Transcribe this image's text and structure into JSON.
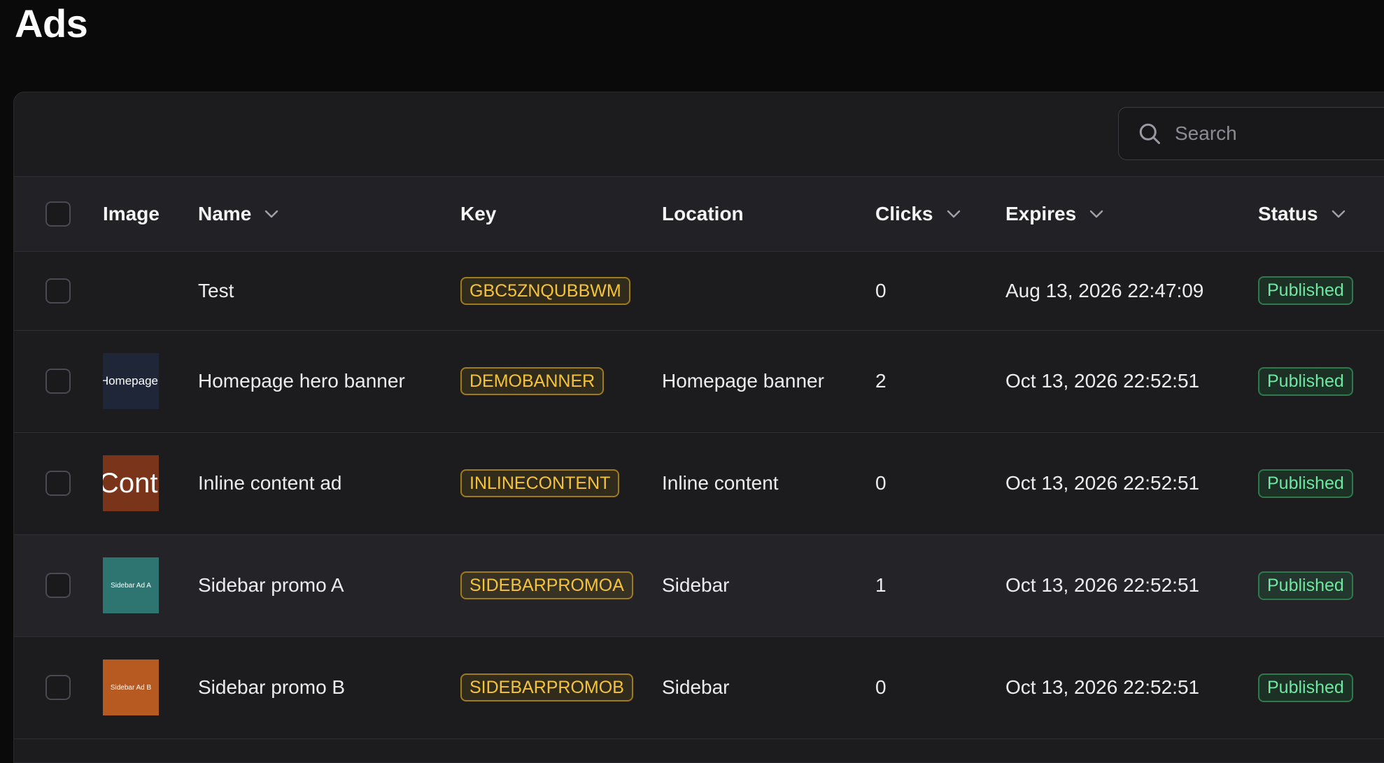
{
  "page": {
    "title": "Ads"
  },
  "search": {
    "placeholder": "Search",
    "value": ""
  },
  "table": {
    "columns": {
      "image": "Image",
      "name": "Name",
      "key": "Key",
      "location": "Location",
      "clicks": "Clicks",
      "expires": "Expires",
      "status": "Status"
    },
    "rows": [
      {
        "image_text": "",
        "image_bg": "",
        "name": "Test",
        "key": "GBC5ZNQUBBWM",
        "location": "",
        "clicks": "0",
        "expires": "Aug 13, 2026 22:47:09",
        "status": "Published"
      },
      {
        "image_text": "Homepage",
        "image_bg": "#1e2638",
        "name": "Homepage hero banner",
        "key": "DEMOBANNER",
        "location": "Homepage banner",
        "clicks": "2",
        "expires": "Oct 13, 2026 22:52:51",
        "status": "Published"
      },
      {
        "image_text": "Content",
        "image_bg": "#7a3419",
        "name": "Inline content ad",
        "key": "INLINECONTENT",
        "location": "Inline content",
        "clicks": "0",
        "expires": "Oct 13, 2026 22:52:51",
        "status": "Published"
      },
      {
        "image_text": "Sidebar Ad A",
        "image_bg": "#2e7470",
        "name": "Sidebar promo A",
        "key": "SIDEBARPROMOA",
        "location": "Sidebar",
        "clicks": "1",
        "expires": "Oct 13, 2026 22:52:51",
        "status": "Published"
      },
      {
        "image_text": "Sidebar Ad B",
        "image_bg": "#b65a22",
        "name": "Sidebar promo B",
        "key": "SIDEBARPROMOB",
        "location": "Sidebar",
        "clicks": "0",
        "expires": "Oct 13, 2026 22:52:51",
        "status": "Published"
      }
    ]
  },
  "colors": {
    "background": "#0a0a0b",
    "panel": "#1c1c1f",
    "key_badge": "#f5c33b",
    "status_published": "#6ee7a0"
  },
  "icons": {
    "search": "search-icon",
    "sort": "chevron-down-icon"
  }
}
